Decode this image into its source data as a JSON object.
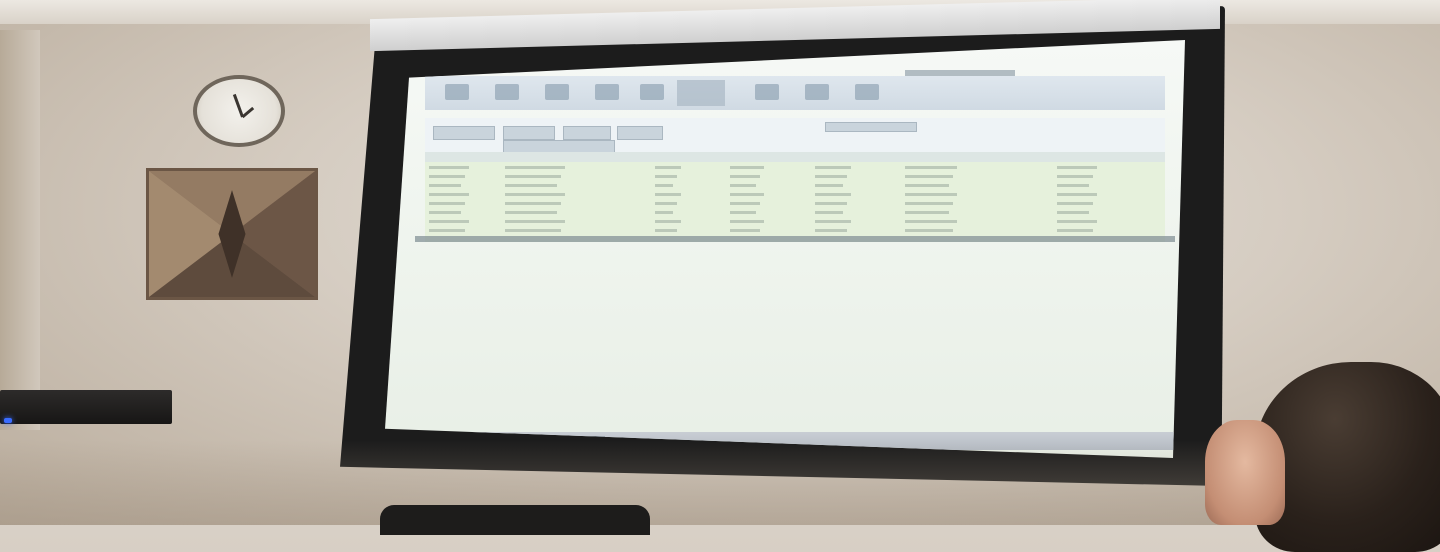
{
  "scene": {
    "objects": [
      "wall-clock",
      "wall-decor-panel",
      "projector-screen",
      "media-shelf",
      "person",
      "chair"
    ],
    "projected_app": {
      "visible_text": []
    }
  },
  "colors": {
    "wall": "#d5ccc1",
    "screen": "#f0f5ef",
    "grid_rows": "#e6f1dc",
    "frame": "#1c1c1c",
    "led": "#3a6cff"
  }
}
